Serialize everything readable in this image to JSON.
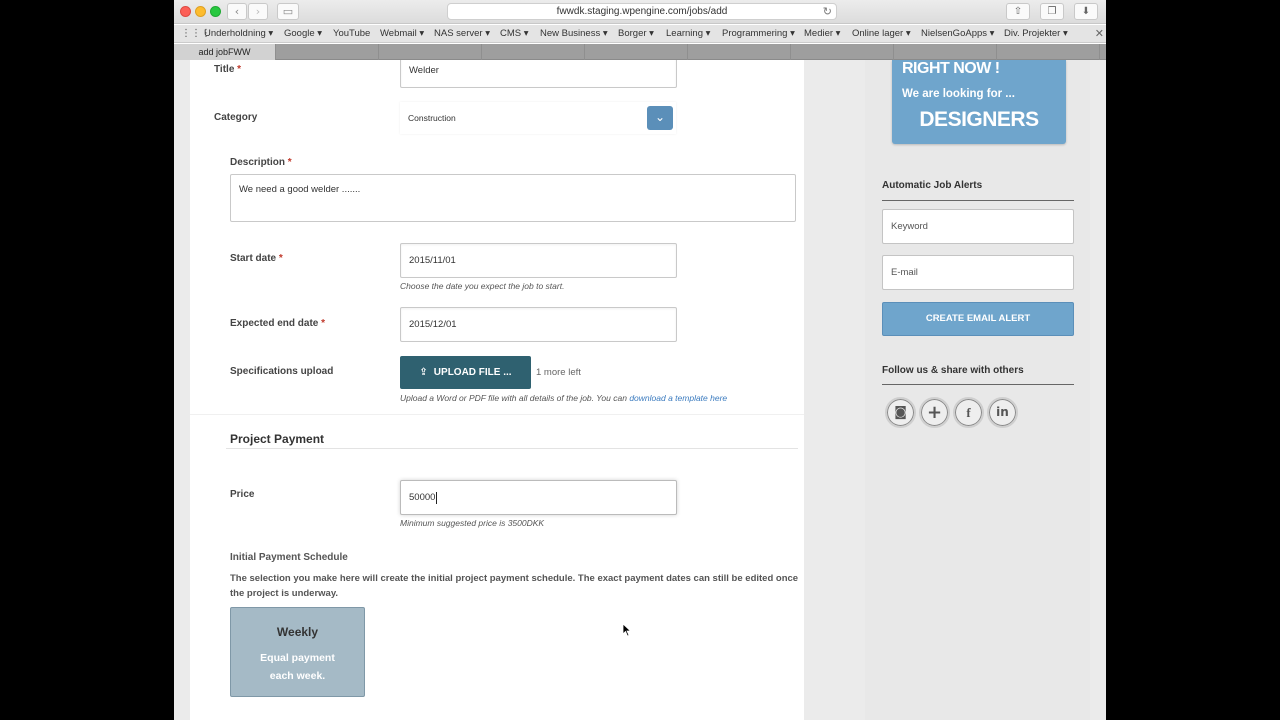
{
  "browser": {
    "url": "fwwdk.staging.wpengine.com/jobs/add",
    "bookmarks": [
      "Underholdning",
      "Google",
      "YouTube",
      "Webmail",
      "NAS server",
      "CMS",
      "New Business",
      "Borger",
      "Learning",
      "Programmering",
      "Medier",
      "Online lager",
      "NielsenGoApps",
      "Div. Projekter"
    ],
    "tabs": [
      {
        "label": "add jobFWW",
        "active": true
      },
      {
        "label": "",
        "active": false
      },
      {
        "label": "",
        "active": false
      },
      {
        "label": "",
        "active": false
      },
      {
        "label": "",
        "active": false
      },
      {
        "label": "",
        "active": false
      },
      {
        "label": "",
        "active": false
      },
      {
        "label": "",
        "active": false
      },
      {
        "label": "",
        "active": false
      }
    ],
    "icons": {
      "back": "chevron-left-icon",
      "forward": "chevron-right-icon",
      "sidebar": "sidebar-icon",
      "reload": "reload-icon",
      "share": "share-icon",
      "tabs": "tabs-icon",
      "download": "download-icon"
    }
  },
  "form": {
    "title_label": "Title",
    "title_value": "Welder",
    "category_label": "Category",
    "category_value": "Construction",
    "description_label": "Description",
    "description_value": "We need a good welder .......",
    "start_date_label": "Start date",
    "start_date_value": "2015/11/01",
    "start_date_hint": "Choose the date you expect the job to start.",
    "end_date_label": "Expected end date",
    "end_date_value": "2015/12/01",
    "upload_label": "Specifications upload",
    "upload_button": "UPLOAD FILE ...",
    "upload_count": "1 more left",
    "upload_hint": "Upload a Word or PDF file with all details of the job. You can",
    "upload_link": "download a template here",
    "required_mark": "*"
  },
  "payment": {
    "section_title": "Project Payment",
    "price_label": "Price",
    "price_value": "50000",
    "price_hint": "Minimum suggested price is 3500DKK",
    "schedule_title": "Initial Payment Schedule",
    "schedule_desc": "The selection you make here will create the initial project payment schedule. The exact payment dates can still be edited once the project is underway.",
    "option_title": "Weekly",
    "option_text": "Equal payment each week."
  },
  "sidebar": {
    "banner_l1": "RIGHT NOW !",
    "banner_l2": "We are looking for ...",
    "banner_l3": "DESIGNERS",
    "alerts_heading": "Automatic Job Alerts",
    "keyword_placeholder": "Keyword",
    "email_placeholder": "E-mail",
    "alert_button": "CREATE EMAIL ALERT",
    "follow_heading": "Follow us & share with others",
    "social": [
      {
        "icon": "instagram-icon",
        "glyph": "◙"
      },
      {
        "icon": "plus-icon",
        "glyph": "+"
      },
      {
        "icon": "facebook-icon",
        "glyph": "f"
      },
      {
        "icon": "linkedin-icon",
        "glyph": "in"
      }
    ]
  },
  "colors": {
    "accent": "#6fa5cc",
    "upload": "#2f6170",
    "option_card": "#a5bac6",
    "required": "#c0392b"
  }
}
